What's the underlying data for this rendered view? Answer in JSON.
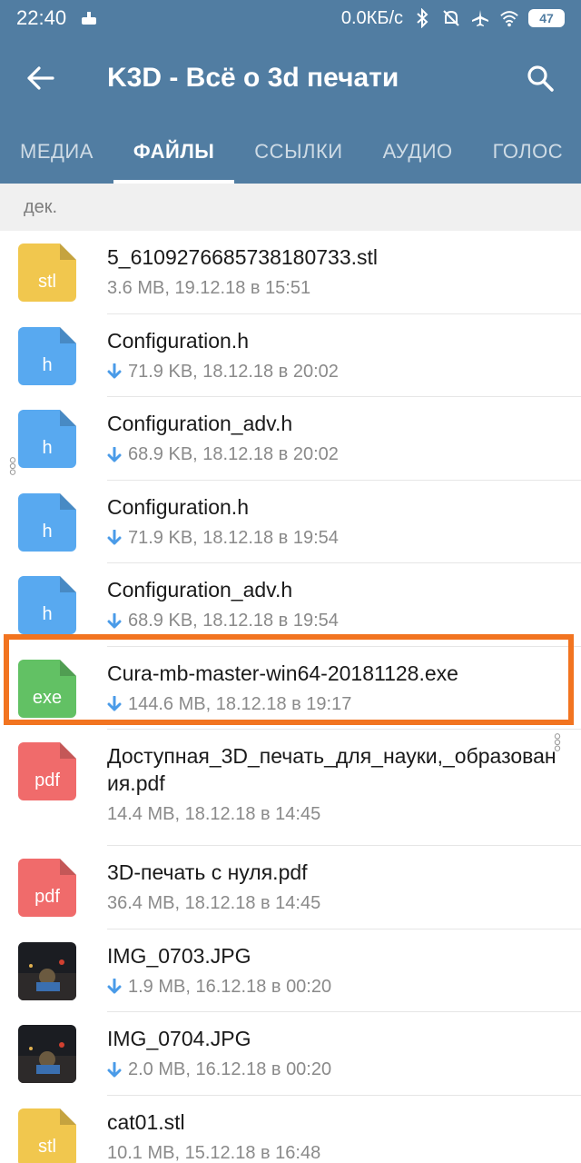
{
  "status_bar": {
    "time": "22:40",
    "speed": "0.0КБ/с",
    "battery": "47"
  },
  "header": {
    "title": "K3D - Всё о 3d печати"
  },
  "tabs": [
    {
      "label": "МЕДИА",
      "active": false
    },
    {
      "label": "ФАЙЛЫ",
      "active": true
    },
    {
      "label": "ССЫЛКИ",
      "active": false
    },
    {
      "label": "АУДИО",
      "active": false
    },
    {
      "label": "ГОЛОС",
      "active": false
    }
  ],
  "section_label": "дек.",
  "files": [
    {
      "name": "5_6109276685738180733.stl",
      "meta": "3.6 MB, 19.12.18 в 15:51",
      "type": "stl",
      "downloadable": false,
      "color": "#f1c74e"
    },
    {
      "name": "Configuration.h",
      "meta": "71.9 KB, 18.12.18 в 20:02",
      "type": "h",
      "downloadable": true,
      "color": "#58a9f0"
    },
    {
      "name": "Configuration_adv.h",
      "meta": "68.9 KB, 18.12.18 в 20:02",
      "type": "h",
      "downloadable": true,
      "color": "#58a9f0"
    },
    {
      "name": "Configuration.h",
      "meta": "71.9 KB, 18.12.18 в 19:54",
      "type": "h",
      "downloadable": true,
      "color": "#58a9f0"
    },
    {
      "name": "Configuration_adv.h",
      "meta": "68.9 KB, 18.12.18 в 19:54",
      "type": "h",
      "downloadable": true,
      "color": "#58a9f0"
    },
    {
      "name": "Cura-mb-master-win64-20181128.exe",
      "meta": "144.6 MB, 18.12.18 в 19:17",
      "type": "exe",
      "downloadable": true,
      "color": "#62c164"
    },
    {
      "name": "Доступная_3D_печать_для_науки,_образования.pdf",
      "meta": "14.4 MB, 18.12.18 в 14:45",
      "type": "pdf",
      "downloadable": false,
      "color": "#f06b6b"
    },
    {
      "name": "3D-печать с нуля.pdf",
      "meta": "36.4 MB, 18.12.18 в 14:45",
      "type": "pdf",
      "downloadable": false,
      "color": "#f06b6b"
    },
    {
      "name": "IMG_0703.JPG",
      "meta": "1.9 MB, 16.12.18 в 00:20",
      "type": "photo",
      "downloadable": true,
      "color": "#2a2a2a"
    },
    {
      "name": "IMG_0704.JPG",
      "meta": "2.0 MB, 16.12.18 в 00:20",
      "type": "photo",
      "downloadable": true,
      "color": "#2a2a2a"
    },
    {
      "name": "cat01.stl",
      "meta": "10.1 MB, 15.12.18 в 16:48",
      "type": "stl",
      "downloadable": false,
      "color": "#f1c74e"
    }
  ],
  "colors": {
    "header_bg": "#517da2",
    "highlight": "#f27420",
    "download_arrow": "#4a9be8"
  }
}
